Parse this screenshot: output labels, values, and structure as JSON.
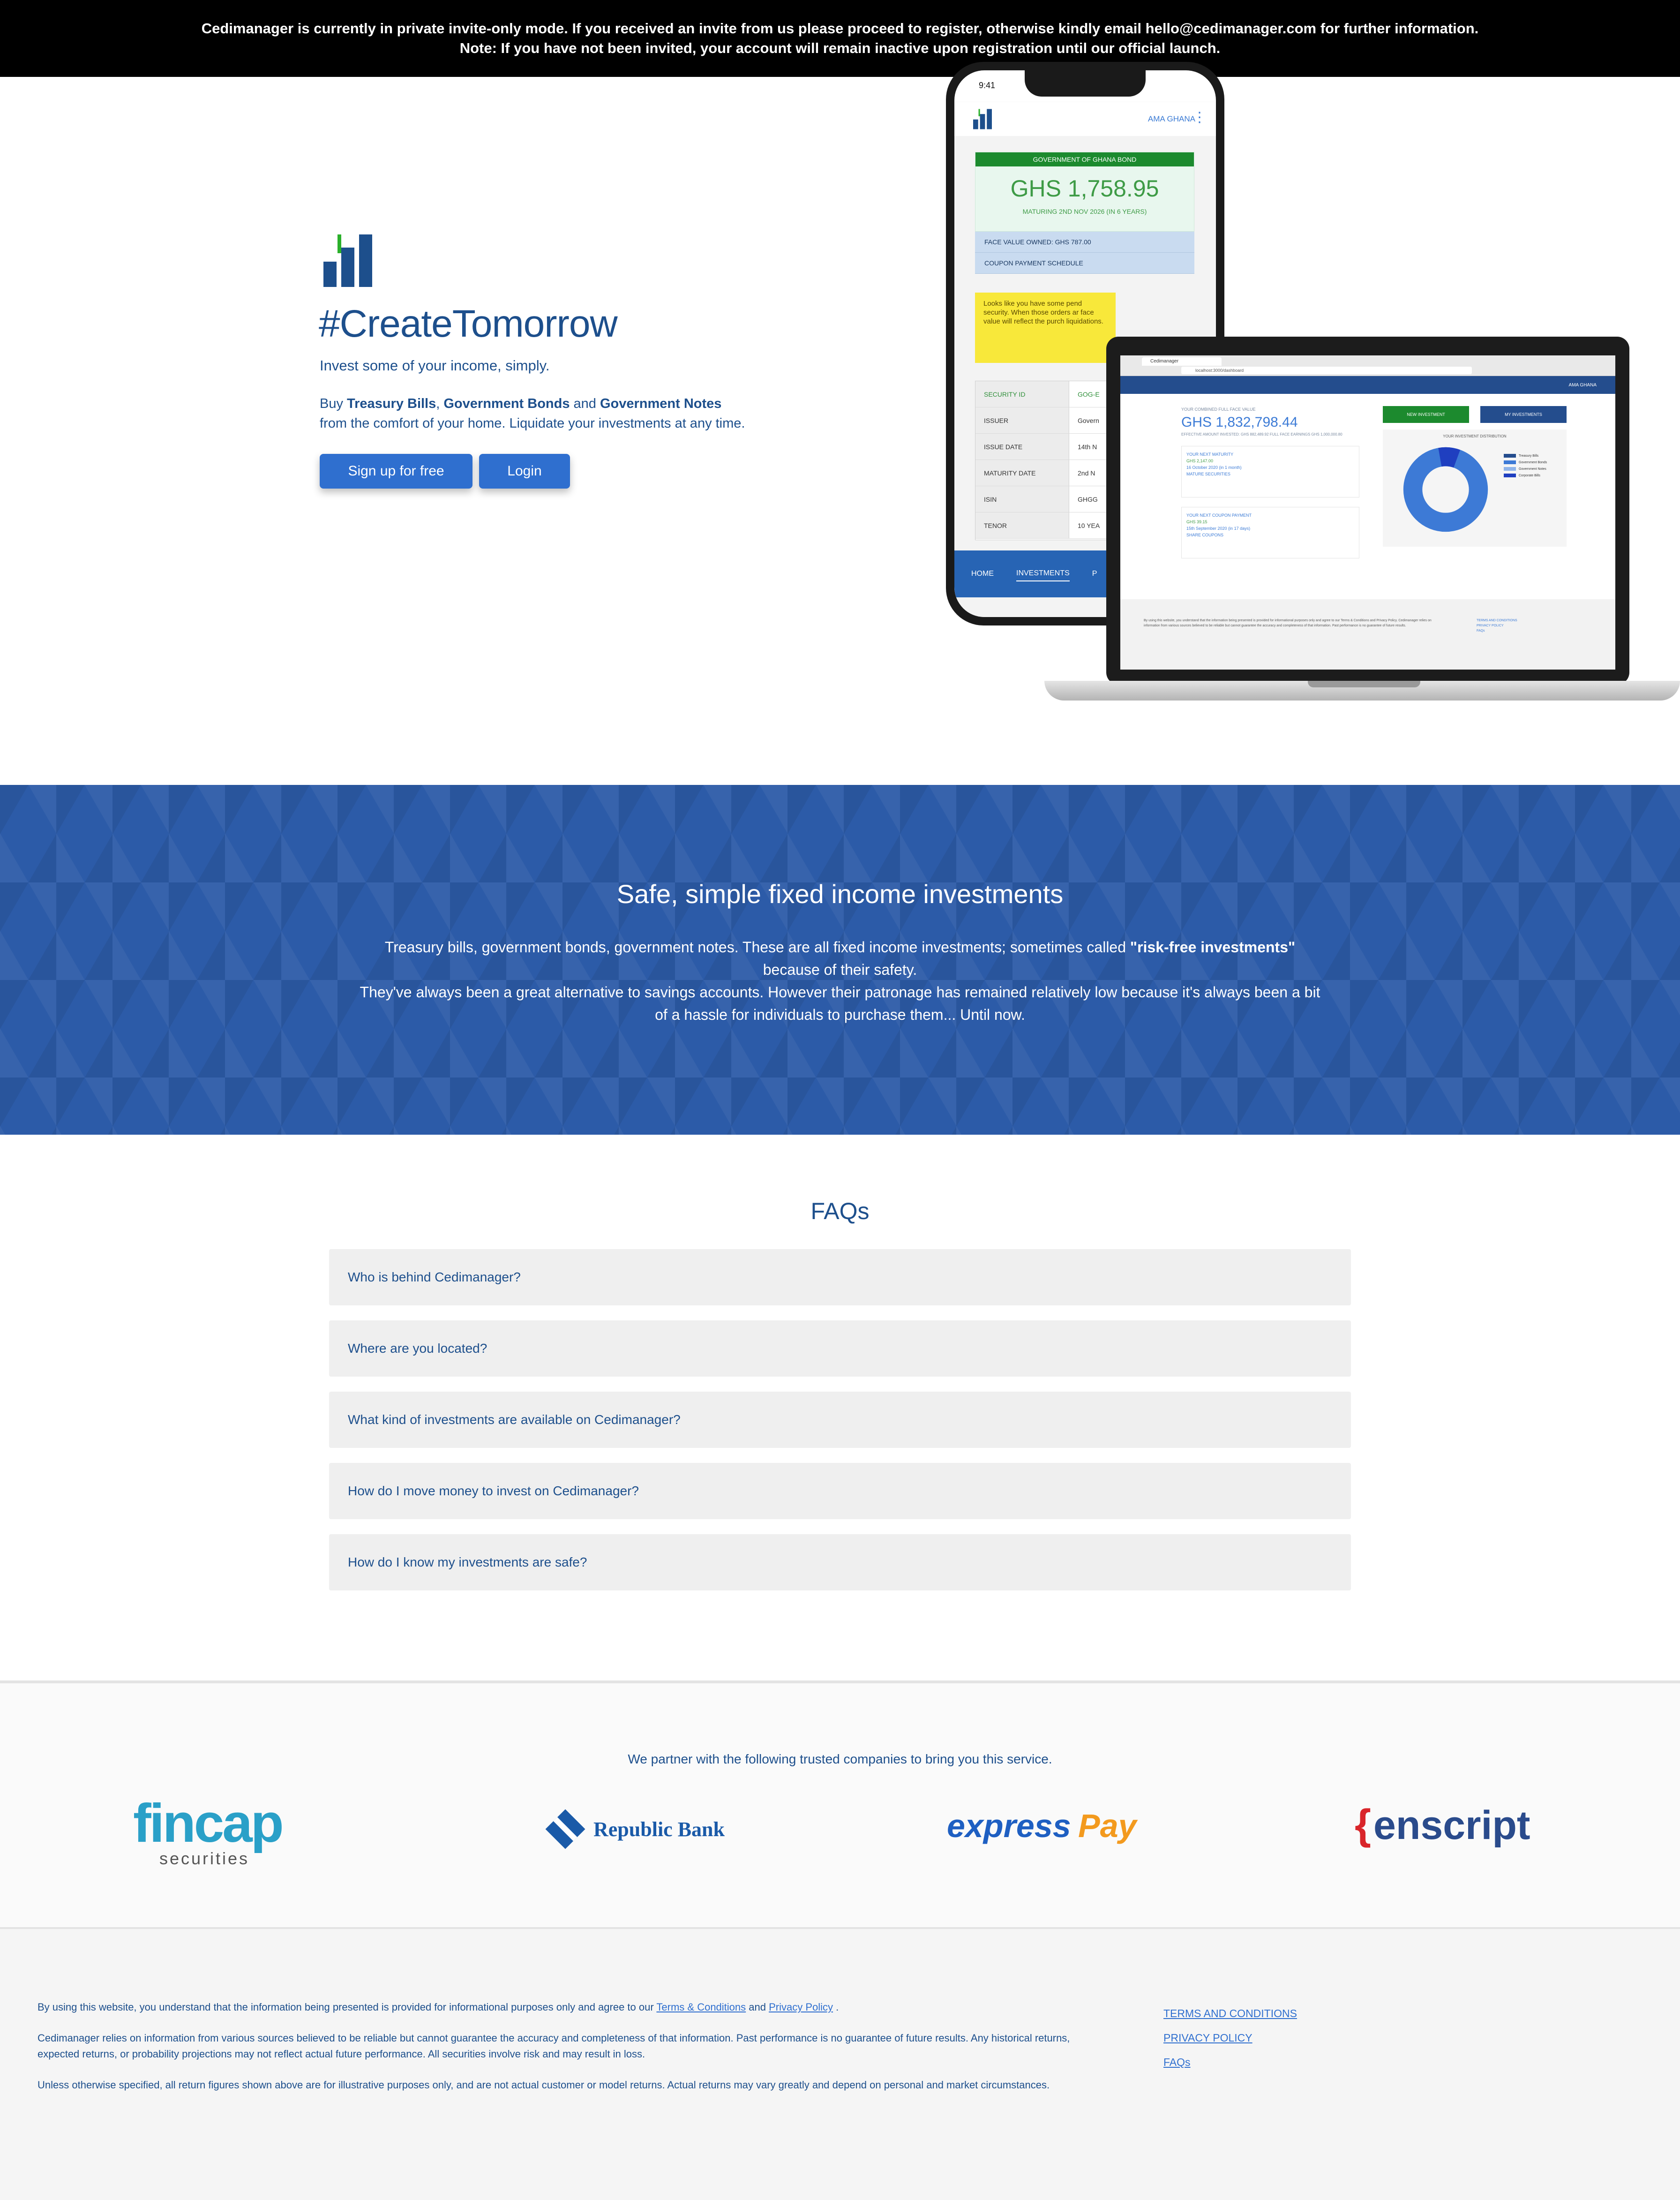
{
  "banner": {
    "line1": "Cedimanager is currently in private invite-only mode. If you received an invite from us please proceed to register, otherwise kindly email hello@cedimanager.com for further information.",
    "line2": "Note: If you have not been invited, your account will remain inactive upon registration until our official launch."
  },
  "hero": {
    "title": "#CreateTomorrow",
    "subtitle": "Invest some of your income, simply.",
    "buy_prefix": "Buy ",
    "buy_item1": "Treasury Bills",
    "buy_sep1": ", ",
    "buy_item2": "Government Bonds",
    "buy_sep2": " and ",
    "buy_item3": "Government Notes",
    "buy_suffix": "from the comfort of your home. Liquidate your investments at any time.",
    "signup_label": "Sign up for free",
    "login_label": "Login"
  },
  "phone": {
    "time": "9:41",
    "user": "AMA GHANA",
    "bond_header": "GOVERNMENT OF GHANA BOND",
    "bond_amount": "GHS 1,758.95",
    "bond_maturing": "MATURING 2ND NOV 2026 (IN 6 YEARS)",
    "face_value": "FACE VALUE OWNED: GHS 787.00",
    "coupon_schedule": "COUPON PAYMENT SCHEDULE",
    "warning": "Looks like you have some pend security. When those orders ar face value will reflect the purch liquidations.",
    "table": [
      {
        "k": "SECURITY ID",
        "v": "GOG-E"
      },
      {
        "k": "ISSUER",
        "v": "Govern"
      },
      {
        "k": "ISSUE DATE",
        "v": "14th N"
      },
      {
        "k": "MATURITY DATE",
        "v": "2nd N"
      },
      {
        "k": "ISIN",
        "v": "GHGG"
      },
      {
        "k": "TENOR",
        "v": "10 YEA"
      }
    ],
    "nav": [
      "HOME",
      "INVESTMENTS",
      "P"
    ]
  },
  "laptop": {
    "tab": "Cedimanager",
    "url": "localhost:3000/dashboard",
    "user": "AMA GHANA",
    "combined_label": "YOUR COMBINED FULL FACE VALUE",
    "combined_amount": "GHS 1,832,798.44",
    "combined_note": "EFFECTIVE AMOUNT INVESTED: GHS 882,489.92 FULL FACE EARNINGS GHS 1,000,000.80",
    "maturity_label": "YOUR NEXT MATURITY",
    "maturity_amount": "GHS 2,147.00",
    "maturity_note": "16 October 2020 (in 1 month)",
    "maturity_btn": "MATURE SECURITIES",
    "coupon_label": "YOUR NEXT COUPON PAYMENT",
    "coupon_amount": "GHS 39.15",
    "coupon_note": "15th September 2020 (in 17 days)",
    "coupon_btn": "SHARE COUPONS",
    "btn_new": "NEW INVESTMENT",
    "btn_my": "MY INVESTMENTS",
    "chart_title": "YOUR INVESTMENT DISTRIBUTION",
    "legend": [
      "Treasury Bills",
      "Government Bonds",
      "Government Notes",
      "Corporate Bills"
    ],
    "footer_text": "By using this website, you understand that the information being presented is provided for informational purposes only and agree to our Terms & Conditions and Privacy Policy. Cedimanager relies on information from various sources believed to be reliable but cannot guarantee the accuracy and completeness of that information. Past performance is no guarantee of future results.",
    "footer_links": [
      "TERMS AND CONDITIONS",
      "PRIVACY POLICY",
      "FAQs"
    ]
  },
  "safe": {
    "title": "Safe, simple fixed income investments",
    "p1": "Treasury bills, government bonds, government notes. These are all fixed income investments; sometimes called ",
    "p1_bold": "\"risk-free investments\"",
    "p1_end": " because of their safety.",
    "p2": "They've always been a great alternative to savings accounts. However their patronage has remained relatively low because it's always been a bit of a hassle for individuals to purchase them... Until now."
  },
  "faq": {
    "title": "FAQs",
    "items": [
      "Who is behind Cedimanager?",
      "Where are you located?",
      "What kind of investments are available on Cedimanager?",
      "How do I move money to invest on Cedimanager?",
      "How do I know my investments are safe?"
    ]
  },
  "partners": {
    "text": "We partner with the following trusted companies to bring you this service.",
    "fincap": "fincap",
    "fincap_sub": "securities",
    "republic": "Republic Bank",
    "express1": "express",
    "express2": "Pay",
    "enscript_brace": "{",
    "enscript": "enscript"
  },
  "footer": {
    "p1_a": "By using this website, you understand that the information being presented is provided for informational purposes only and agree to our ",
    "p1_terms": "Terms & Conditions",
    "p1_and": " and ",
    "p1_privacy": "Privacy Policy",
    "p1_end": " .",
    "p2": "Cedimanager relies on information from various sources believed to be reliable but cannot guarantee the accuracy and completeness of that information. Past performance is no guarantee of future results. Any historical returns, expected returns, or probability projections may not reflect actual future performance. All securities involve risk and may result in loss.",
    "p3": "Unless otherwise specified, all return figures shown above are for illustrative purposes only, and are not actual customer or model returns. Actual returns may vary greatly and depend on personal and market circumstances.",
    "links": [
      "TERMS AND CONDITIONS",
      "PRIVACY POLICY",
      "FAQs"
    ]
  },
  "colors": {
    "brand_blue": "#1d4f8c",
    "button_blue": "#2f6fcf",
    "section_blue": "#2c5ba8",
    "bond_green": "#1c8a2e"
  }
}
